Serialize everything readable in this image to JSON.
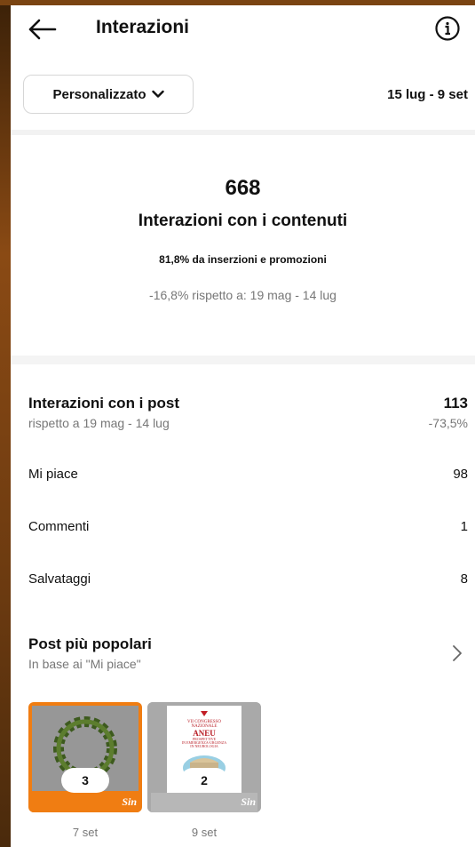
{
  "header": {
    "title": "Interazioni"
  },
  "filter": {
    "label": "Personalizzato",
    "date_range": "15 lug - 9 set"
  },
  "summary": {
    "total": "668",
    "label": "Interazioni con i contenuti",
    "ads_share": "81,8% da inserzioni e promozioni",
    "comparison": "-16,8% rispetto a: 19 mag - 14 lug"
  },
  "post_interactions": {
    "title": "Interazioni con i post",
    "subtitle": "rispetto a 19 mag - 14 lug",
    "value": "113",
    "change": "-73,5%",
    "metrics": [
      {
        "label": "Mi piace",
        "value": "98"
      },
      {
        "label": "Commenti",
        "value": "1"
      },
      {
        "label": "Salvataggi",
        "value": "8"
      }
    ]
  },
  "popular_posts": {
    "title": "Post più popolari",
    "subtitle": "In base ai \"Mi piace\"",
    "posts": [
      {
        "count": "3",
        "date": "7 set",
        "brand": "Sin",
        "brand_color": "#f07d12"
      },
      {
        "count": "2",
        "date": "9 set",
        "brand": "Sin",
        "brand_color": "#b7b7b7",
        "poster_lines": [
          "VII CONGRESSO",
          "NAZIONALE",
          "ANEU",
          "PROSPETTIVE",
          "IN EMERGENZA-URGENZA",
          "IN NEUROLOGIA"
        ]
      }
    ]
  },
  "icons": {
    "back": "arrow-left-icon",
    "info": "info-icon",
    "dropdown": "chevron-down-icon",
    "more": "chevron-right-icon"
  }
}
